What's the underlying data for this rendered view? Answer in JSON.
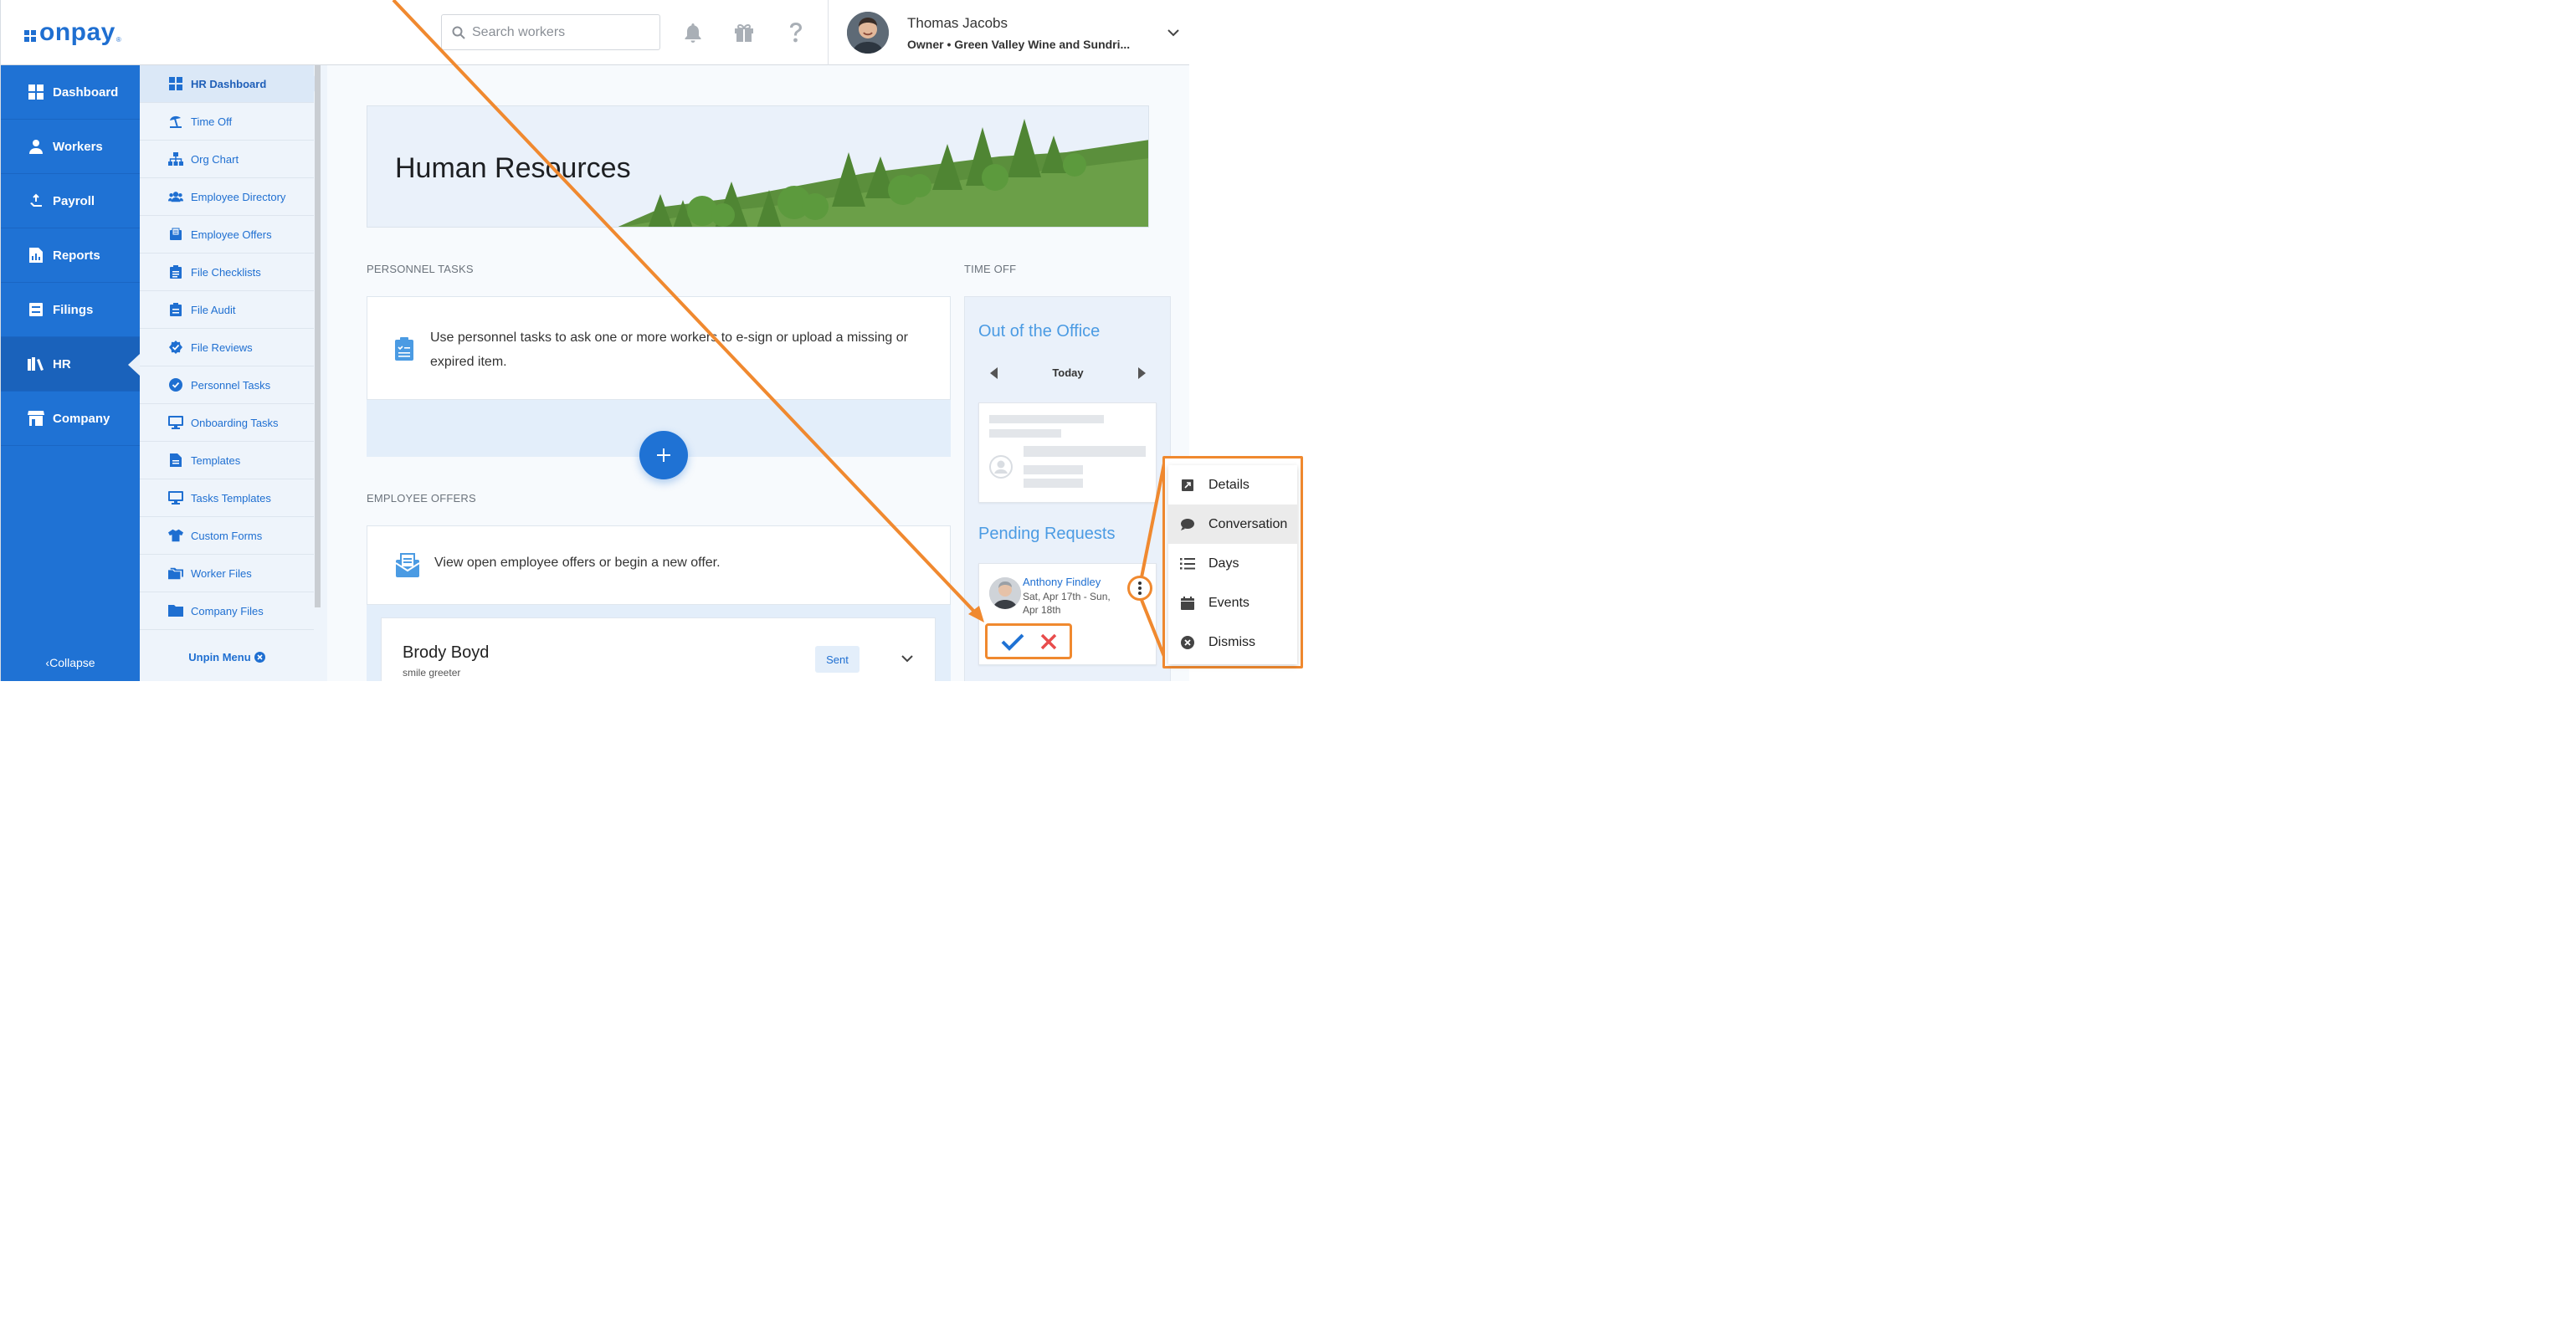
{
  "brand": {
    "name": "onpay",
    "accent": "#1f72d4",
    "annotation_color": "#f0892f"
  },
  "header": {
    "search_placeholder": "Search workers",
    "icons": [
      "bell-icon",
      "gift-icon",
      "help-icon"
    ],
    "user": {
      "name": "Thomas Jacobs",
      "subtitle": "Owner • Green Valley Wine and Sundri..."
    }
  },
  "main_nav": {
    "items": [
      {
        "label": "Dashboard",
        "icon": "dashboard-icon"
      },
      {
        "label": "Workers",
        "icon": "workers-icon"
      },
      {
        "label": "Payroll",
        "icon": "payroll-icon"
      },
      {
        "label": "Reports",
        "icon": "reports-icon"
      },
      {
        "label": "Filings",
        "icon": "filings-icon"
      },
      {
        "label": "HR",
        "icon": "hr-icon",
        "active": true
      },
      {
        "label": "Company",
        "icon": "company-icon"
      }
    ],
    "collapse_label": "Collapse"
  },
  "sub_nav": {
    "items": [
      {
        "label": "HR Dashboard",
        "active": true
      },
      {
        "label": "Time Off"
      },
      {
        "label": "Org Chart"
      },
      {
        "label": "Employee Directory"
      },
      {
        "label": "Employee Offers"
      },
      {
        "label": "File Checklists"
      },
      {
        "label": "File Audit"
      },
      {
        "label": "File Reviews"
      },
      {
        "label": "Personnel Tasks"
      },
      {
        "label": "Onboarding Tasks"
      },
      {
        "label": "Templates"
      },
      {
        "label": "Tasks Templates"
      },
      {
        "label": "Custom Forms"
      },
      {
        "label": "Worker Files"
      },
      {
        "label": "Company Files"
      }
    ],
    "unpin_label": "Unpin Menu"
  },
  "hero": {
    "title": "Human Resources"
  },
  "personnel_tasks": {
    "section_label": "PERSONNEL TASKS",
    "description": "Use personnel tasks to ask one or more workers to e-sign or upload a missing or expired item."
  },
  "employee_offers": {
    "section_label": "EMPLOYEE OFFERS",
    "description": "View open employee offers or begin a new offer.",
    "offer": {
      "name": "Brody Boyd",
      "role": "smile greeter",
      "status": "Sent"
    }
  },
  "time_off": {
    "section_label": "TIME OFF",
    "out_of_office_title": "Out of the Office",
    "date_label": "Today",
    "pending_title": "Pending Requests",
    "request": {
      "name": "Anthony Findley",
      "dates": "Sat, Apr 17th - Sun, Apr 18th"
    }
  },
  "context_menu": {
    "items": [
      {
        "label": "Details",
        "icon": "open-external-icon"
      },
      {
        "label": "Conversation",
        "icon": "chat-bubble-icon",
        "hover": true
      },
      {
        "label": "Days",
        "icon": "list-icon"
      },
      {
        "label": "Events",
        "icon": "calendar-icon"
      },
      {
        "label": "Dismiss",
        "icon": "close-circle-icon"
      }
    ]
  }
}
